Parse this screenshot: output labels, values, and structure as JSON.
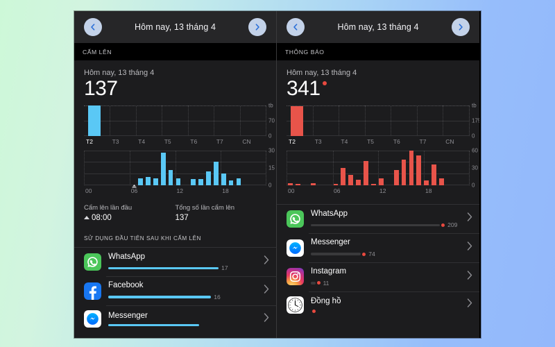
{
  "background": {
    "from": "#cdf8d8",
    "to": "#93b8fb"
  },
  "panels": [
    {
      "id": "pickup",
      "nav": {
        "back_icon": "chevron-left-icon",
        "forward_icon": "chevron-right-icon",
        "title": "Hôm nay, 13 tháng 4"
      },
      "section_header": "CẤM LÊN",
      "day_label": "Hôm nay, 13 tháng 4",
      "total": "137",
      "has_red_dot": false,
      "accent": "#5ac8f5",
      "week_chart": {
        "type": "bar",
        "categories": [
          "T2",
          "T3",
          "T4",
          "T5",
          "T6",
          "T7",
          "CN"
        ],
        "values": [
          137,
          0,
          0,
          0,
          0,
          0,
          0
        ],
        "ylabels": [
          "tb",
          "70",
          "0"
        ],
        "ymax": 140,
        "active_index": 0
      },
      "hours_chart": {
        "type": "bar",
        "xlabels": [
          "00",
          "06",
          "12",
          "18"
        ],
        "ylabels": [
          "30",
          "15",
          "0"
        ],
        "ymax": 30,
        "values": [
          0,
          0,
          0,
          0,
          0,
          0,
          0,
          6,
          7,
          6,
          28,
          13,
          6,
          0,
          5,
          5,
          12,
          20,
          10,
          4,
          6,
          0,
          0,
          0
        ],
        "wake_marker_hour": 7,
        "wake_marker_icon": "wake-up-icon"
      },
      "stats": [
        {
          "label": "Cẩm lên lần đầu",
          "value": "08:00",
          "icon": "up-triangle-icon"
        },
        {
          "label": "Tổng số lần cẩm lên",
          "value": "137",
          "icon": ""
        }
      ],
      "sub_header": "SỬ DỤNG ĐẦU TIÊN SAU KHI CẤM LÊN",
      "apps": [
        {
          "name": "WhatsApp",
          "count": "17",
          "bar_pct": 73,
          "icon": "whatsapp-icon",
          "chevron": "chevron-right-icon"
        },
        {
          "name": "Facebook",
          "count": "16",
          "bar_pct": 68,
          "icon": "facebook-icon",
          "chevron": "chevron-right-icon"
        },
        {
          "name": "Messenger",
          "count": "",
          "bar_pct": 60,
          "icon": "messenger-icon",
          "chevron": "chevron-right-icon"
        }
      ]
    },
    {
      "id": "notifications",
      "nav": {
        "back_icon": "chevron-left-icon",
        "forward_icon": "chevron-right-icon",
        "title": "Hôm nay, 13 tháng 4"
      },
      "section_header": "THÔNG BÁO",
      "day_label": "Hôm nay, 13 tháng 4",
      "total": "341",
      "has_red_dot": true,
      "accent": "#e8544a",
      "week_chart": {
        "type": "bar",
        "categories": [
          "T2",
          "T3",
          "T4",
          "T5",
          "T6",
          "T7",
          "CN"
        ],
        "values": [
          341,
          0,
          0,
          0,
          0,
          0,
          0
        ],
        "ylabels": [
          "tb",
          "175",
          "0"
        ],
        "ymax": 350,
        "active_index": 0
      },
      "hours_chart": {
        "type": "bar",
        "xlabels": [
          "00",
          "06",
          "12",
          "18"
        ],
        "ylabels": [
          "60",
          "30",
          "0"
        ],
        "ymax": 60,
        "values": [
          3,
          2,
          0,
          3,
          0,
          0,
          2,
          29,
          17,
          9,
          42,
          2,
          12,
          0,
          26,
          44,
          59,
          51,
          8,
          36,
          11,
          0,
          0,
          0
        ],
        "wake_marker_hour": null,
        "wake_marker_icon": ""
      },
      "stats": [],
      "sub_header": "",
      "apps": [
        {
          "name": "WhatsApp",
          "count": "209",
          "bar_pct": 85,
          "icon": "whatsapp-icon",
          "chevron": "chevron-right-icon"
        },
        {
          "name": "Messenger",
          "count": "74",
          "bar_pct": 33,
          "icon": "messenger-icon",
          "chevron": "chevron-right-icon"
        },
        {
          "name": "Instagram",
          "count": "11",
          "bar_pct": 3,
          "icon": "instagram-icon",
          "chevron": "chevron-right-icon"
        },
        {
          "name": "Đồng hồ",
          "count": "",
          "bar_pct": 0,
          "icon": "clock-icon",
          "chevron": "chevron-right-icon"
        }
      ]
    }
  ]
}
